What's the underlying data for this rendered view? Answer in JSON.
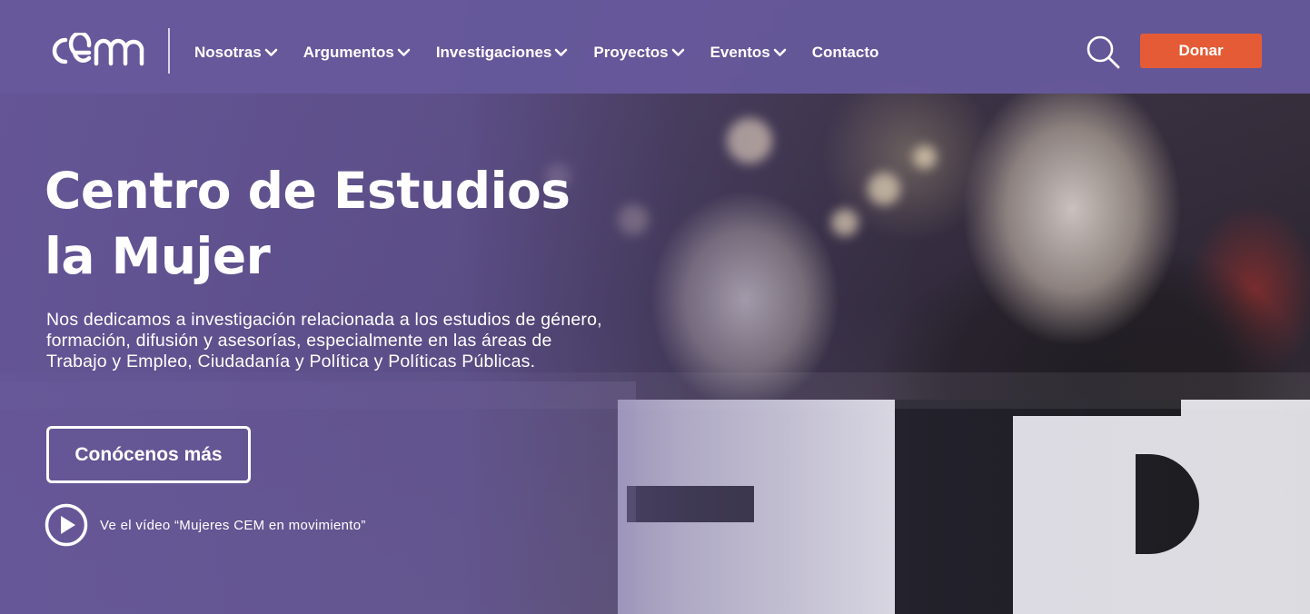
{
  "header": {
    "logo_text": "cem",
    "nav": [
      {
        "label": "Nosotras",
        "has_dropdown": true
      },
      {
        "label": "Argumentos",
        "has_dropdown": true
      },
      {
        "label": "Investigaciones",
        "has_dropdown": true
      },
      {
        "label": "Proyectos",
        "has_dropdown": true
      },
      {
        "label": "Eventos",
        "has_dropdown": true
      },
      {
        "label": "Contacto",
        "has_dropdown": false
      }
    ],
    "search_icon": "search-icon",
    "donate_label": "Donar"
  },
  "hero": {
    "title_line1": "Centro de Estudios",
    "title_line2": "la Mujer",
    "description": "Nos dedicamos a investigación relacionada a los estudios de género, formación, difusión y asesorías, especialmente en las áreas de Trabajo y Empleo, Ciudadanía y Política y Políticas Públicas.",
    "cta_label": "Conócenos más",
    "video_label": "Ve el vídeo “Mujeres CEM en movimiento”",
    "video_icon": "play-circle-icon"
  },
  "colors": {
    "header_bg": "#66589b",
    "donate_bg": "#e55b36",
    "text": "#ffffff"
  }
}
